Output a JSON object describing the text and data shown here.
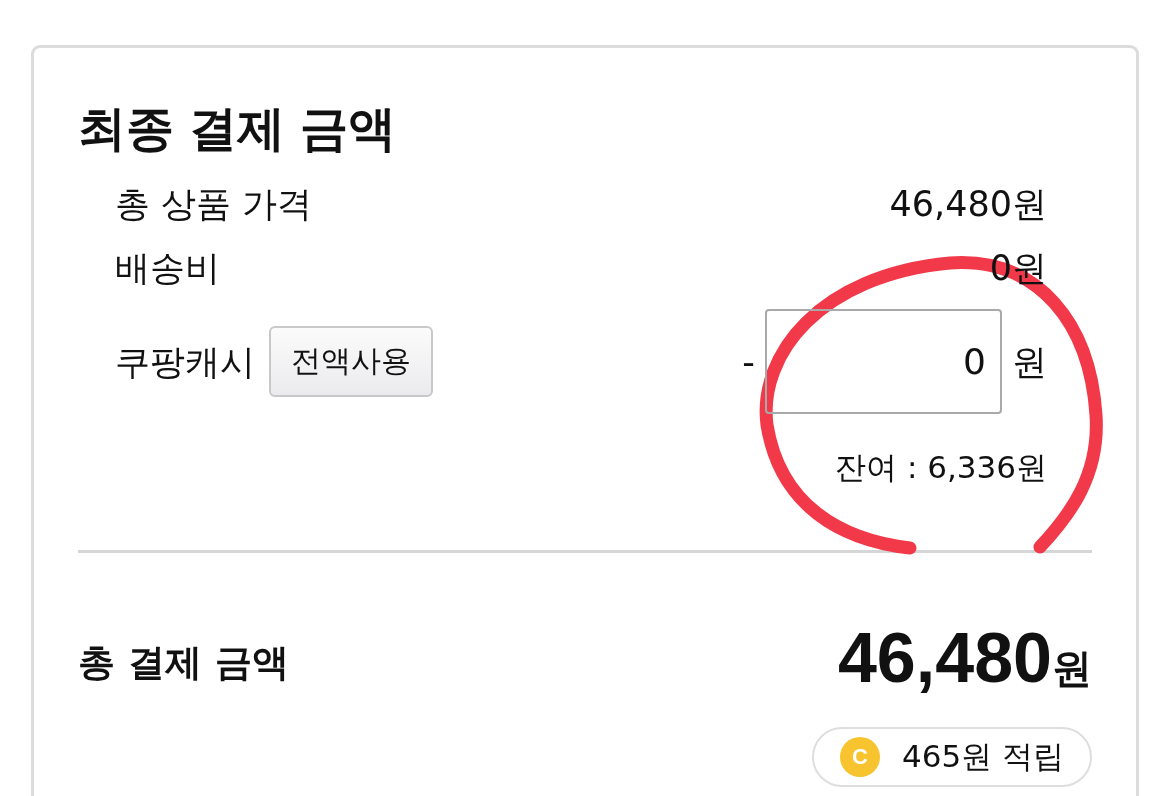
{
  "section": {
    "title": "최종 결제 금액"
  },
  "rows": [
    {
      "kind": "amount",
      "label": "총 상품 가격",
      "value": "46,480원"
    },
    {
      "kind": "amount",
      "label": "배송비",
      "value": "0원"
    },
    {
      "kind": "cash",
      "label": "쿠팡캐시",
      "button": "전액사용",
      "sign": "-",
      "input_value": "0",
      "unit": "원",
      "balance": "잔여 : 6,336원"
    }
  ],
  "total": {
    "label": "총 결제 금액",
    "amount": "46,480",
    "unit": "원"
  },
  "reward": {
    "coin_letter": "C",
    "text": "465원 적립"
  }
}
